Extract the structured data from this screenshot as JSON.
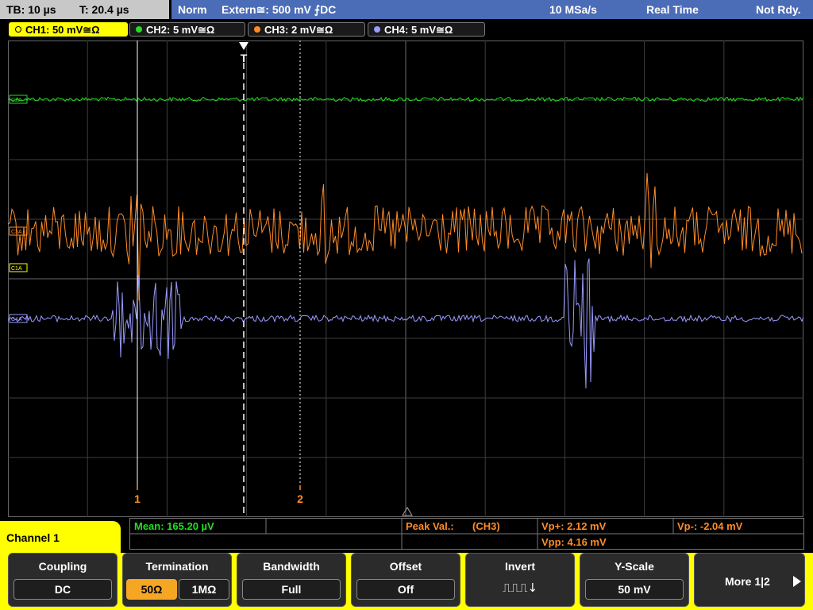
{
  "top": {
    "tb": "TB: 10 µs",
    "t": "T: 20.4 µs",
    "mode": "Norm",
    "trigger": "Extern≅: 500 mV ⨍DC",
    "rate": "10 MSa/s",
    "acq": "Real Time",
    "status": "Not Rdy."
  },
  "channels": [
    {
      "label": "CH1: 50 mV≅Ω",
      "color": "#ffff00",
      "active": true
    },
    {
      "label": "CH2: 5 mV≅Ω",
      "color": "#22dd22",
      "active": false
    },
    {
      "label": "CH3: 2 mV≅Ω",
      "color": "#ff8c28",
      "active": false
    },
    {
      "label": "CH4: 5 mV≅Ω",
      "color": "#9a9aff",
      "active": false
    }
  ],
  "markers": {
    "trigger": "T",
    "cursor1": "1",
    "cursor2": "2"
  },
  "trace_labels": {
    "ch2": "C2A",
    "ch3": "C3A",
    "ch1": "C1A",
    "ch4": "C4A"
  },
  "measurements": {
    "mean": "Mean: 165.20 µV",
    "peak_label": "Peak Val.:",
    "peak_source": "(CH3)",
    "vp_plus": "Vp+: 2.12 mV",
    "vp_minus": "Vp-: -2.04 mV",
    "vpp": "Vpp: 4.16 mV"
  },
  "channel_menu": {
    "title": "Channel 1"
  },
  "softkeys": {
    "coupling": {
      "title": "Coupling",
      "value": "DC"
    },
    "termination": {
      "title": "Termination",
      "opt1": "50Ω",
      "opt2": "1MΩ"
    },
    "bandwidth": {
      "title": "Bandwidth",
      "value": "Full"
    },
    "offset": {
      "title": "Offset",
      "value": "Off"
    },
    "invert": {
      "title": "Invert",
      "symbol": "⎍⎍⎍↓"
    },
    "yscale": {
      "title": "Y-Scale",
      "value": "50 mV"
    },
    "more": {
      "title": "More 1|2"
    }
  },
  "colors": {
    "ch1": "#ffff00",
    "ch2": "#22dd22",
    "ch3": "#ff8c28",
    "ch4": "#9a9aff",
    "header": "#4b6cb7",
    "grid": "#555555"
  }
}
